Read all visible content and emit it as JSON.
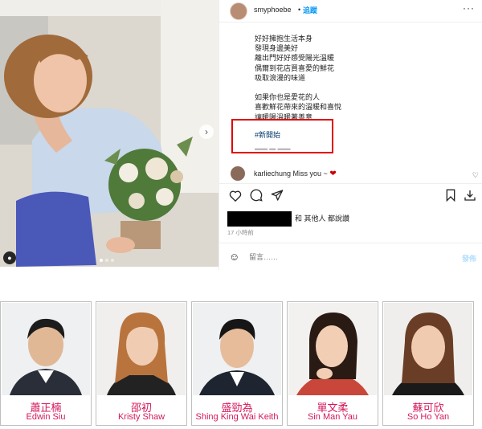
{
  "post": {
    "username": "smyphoebe",
    "separator": "•",
    "follow_label": "追蹤",
    "more_label": "···",
    "caption_lines": [
      "好好擁抱生活本身",
      "發現身邊美好",
      "離出門好好感受陽光溫暖",
      "偶爾到花店買喜愛的鮮花",
      "吸取浪漫的味道",
      "",
      "如果你也是愛花的人",
      "喜歡鮮花帶來的溫暖和喜悅",
      "讓暖陽溫暖著善意"
    ],
    "hashtag": "#新開始",
    "comment": {
      "user": "karliechung",
      "text": "Miss you ~"
    },
    "likes_text": "和 其他人 都說讚",
    "time_text": "17 小時前",
    "comment_placeholder": "留言……",
    "post_button": "發佈",
    "icons": [
      "heart-icon",
      "comment-icon",
      "share-icon",
      "bookmark-icon",
      "download-icon",
      "emoji-icon"
    ],
    "highlight_color": "#e00000"
  },
  "cast": [
    {
      "name_zh": "蕭正楠",
      "name_en": "Edwin Siu"
    },
    {
      "name_zh": "邵初",
      "name_en": "Kristy Shaw"
    },
    {
      "name_zh": "盛勁為",
      "name_en": "Shing King Wai Keith"
    },
    {
      "name_zh": "單文柔",
      "name_en": "Sin Man Yau"
    },
    {
      "name_zh": "蘇可欣",
      "name_en": "So Ho Yan"
    }
  ],
  "colors": {
    "cast_name": "#d4175c",
    "link_blue": "#0095f6",
    "hashtag": "#00376b"
  }
}
